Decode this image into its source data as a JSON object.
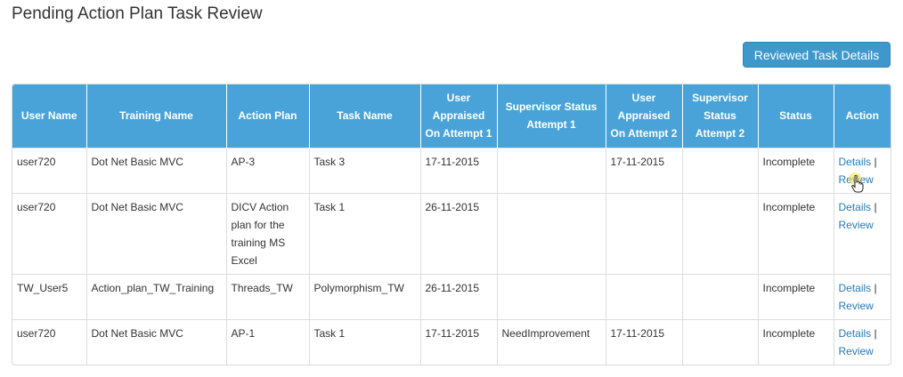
{
  "page": {
    "title": "Pending Action Plan Task Review"
  },
  "toolbar": {
    "reviewed_label": "Reviewed Task Details"
  },
  "table": {
    "headers": [
      "User Name",
      "Training Name",
      "Action Plan",
      "Task Name",
      "User Appraised On Attempt 1",
      "Supervisor Status Attempt 1",
      "User Appraised On Attempt 2",
      "Supervisor Status Attempt 2",
      "Status",
      "Action"
    ],
    "rows": [
      {
        "user": "user720",
        "training": "Dot Net Basic MVC",
        "plan": "AP-3",
        "task": "Task 3",
        "appraised1": "17-11-2015",
        "sup1": "",
        "appraised2": "17-11-2015",
        "sup2": "",
        "status": "Incomplete",
        "details": "Details",
        "sep": "|",
        "review": "Review"
      },
      {
        "user": "user720",
        "training": "Dot Net Basic MVC",
        "plan": "DICV Action plan for the training MS Excel",
        "task": "Task 1",
        "appraised1": "26-11-2015",
        "sup1": "",
        "appraised2": "",
        "sup2": "",
        "status": "Incomplete",
        "details": "Details",
        "sep": "|",
        "review": "Review"
      },
      {
        "user": "TW_User5",
        "training": "Action_plan_TW_Training",
        "plan": "Threads_TW",
        "task": "Polymorphism_TW",
        "appraised1": "26-11-2015",
        "sup1": "",
        "appraised2": "",
        "sup2": "",
        "status": "Incomplete",
        "details": "Details",
        "sep": "|",
        "review": "Review"
      },
      {
        "user": "user720",
        "training": "Dot Net Basic MVC",
        "plan": "AP-1",
        "task": "Task 1",
        "appraised1": "17-11-2015",
        "sup1": "NeedImprovement",
        "appraised2": "17-11-2015",
        "sup2": "",
        "status": "Incomplete",
        "details": "Details",
        "sep": "|",
        "review": "Review"
      }
    ]
  },
  "colors": {
    "header_bg": "#4aa3d8",
    "button_bg": "#3e98cc",
    "link": "#2a7ab7",
    "border": "#dddddd"
  },
  "icons": {
    "cursor": "hand-pointer-icon"
  }
}
